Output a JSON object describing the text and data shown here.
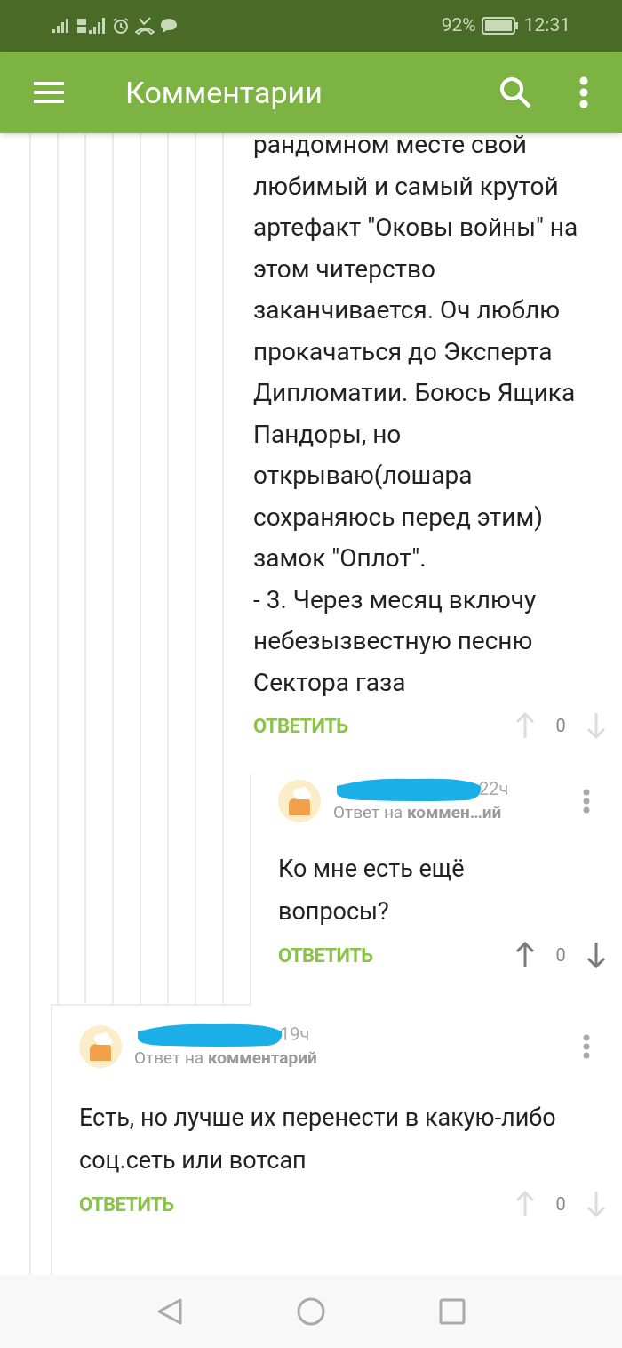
{
  "status_bar": {
    "battery": "92%",
    "time": "12:31"
  },
  "app_bar": {
    "title": "Комментарии"
  },
  "comments": [
    {
      "text": "рандомном месте свой любимый и самый крутой артефакт \"Оковы войны\" на этом читерство заканчивается. Оч люблю прокачаться до Эксперта Дипломатии. Боюсь Ящика Пандоры, но открываю(лошара сохраняюсь перед этим) замок \"Оплот\".\n- 3. Через месяц включу небезызвестную песню Сектора газа",
      "reply_label": "ОТВЕТИТЬ",
      "score": "0",
      "voting_enabled": false,
      "children": [
        {
          "time": "22ч",
          "reply_to": "Ответ на **коммен…ий**",
          "text": "Ко мне есть ещё вопросы?",
          "reply_label": "ОТВЕТИТЬ",
          "score": "0",
          "voting_enabled": true
        }
      ]
    },
    {
      "time": "19ч",
      "reply_to": "Ответ на **комментарий**",
      "text": "Есть, но лучше их перенести в какую-либо соц.сеть или вотсап",
      "reply_label": "ОТВЕТИТЬ",
      "score": "0",
      "voting_enabled": false
    }
  ]
}
